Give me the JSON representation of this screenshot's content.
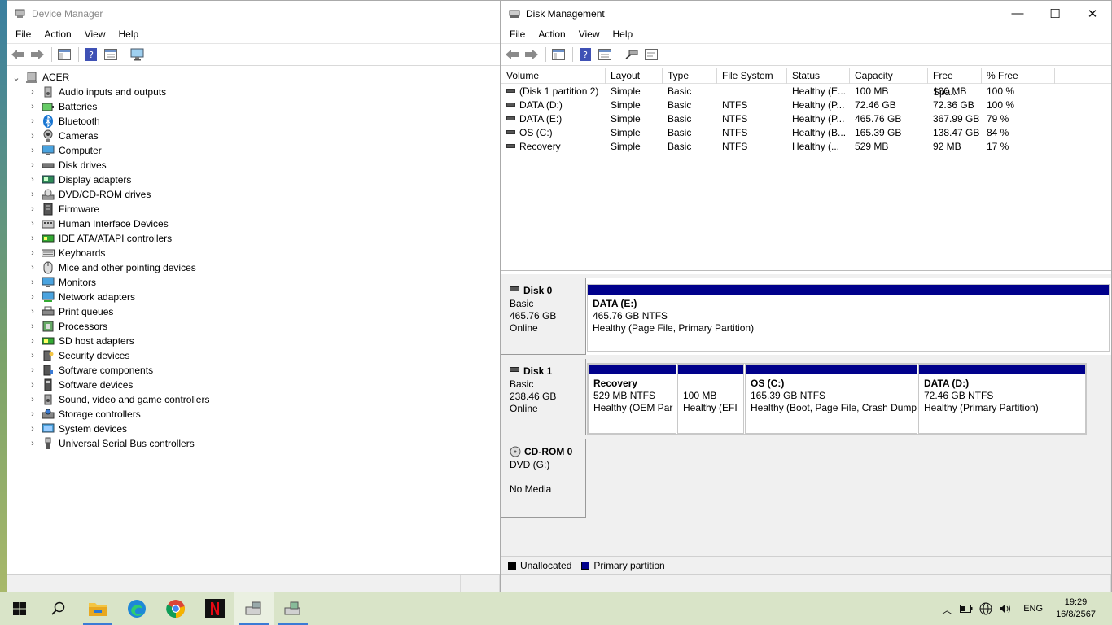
{
  "device_manager": {
    "title": "Device Manager",
    "menu": [
      "File",
      "Action",
      "View",
      "Help"
    ],
    "root": "ACER",
    "categories": [
      {
        "label": "Audio inputs and outputs",
        "icon": "speaker-icon"
      },
      {
        "label": "Batteries",
        "icon": "battery-icon"
      },
      {
        "label": "Bluetooth",
        "icon": "bluetooth-icon"
      },
      {
        "label": "Cameras",
        "icon": "camera-icon"
      },
      {
        "label": "Computer",
        "icon": "computer-icon"
      },
      {
        "label": "Disk drives",
        "icon": "disk-drive-icon"
      },
      {
        "label": "Display adapters",
        "icon": "display-adapter-icon"
      },
      {
        "label": "DVD/CD-ROM drives",
        "icon": "dvd-icon"
      },
      {
        "label": "Firmware",
        "icon": "firmware-icon"
      },
      {
        "label": "Human Interface Devices",
        "icon": "hid-icon"
      },
      {
        "label": "IDE ATA/ATAPI controllers",
        "icon": "ide-controller-icon"
      },
      {
        "label": "Keyboards",
        "icon": "keyboard-icon"
      },
      {
        "label": "Mice and other pointing devices",
        "icon": "mouse-icon"
      },
      {
        "label": "Monitors",
        "icon": "monitor-icon"
      },
      {
        "label": "Network adapters",
        "icon": "network-adapter-icon"
      },
      {
        "label": "Print queues",
        "icon": "printer-icon"
      },
      {
        "label": "Processors",
        "icon": "processor-icon"
      },
      {
        "label": "SD host adapters",
        "icon": "sd-card-icon"
      },
      {
        "label": "Security devices",
        "icon": "security-device-icon"
      },
      {
        "label": "Software components",
        "icon": "software-component-icon"
      },
      {
        "label": "Software devices",
        "icon": "software-device-icon"
      },
      {
        "label": "Sound, video and game controllers",
        "icon": "sound-controller-icon"
      },
      {
        "label": "Storage controllers",
        "icon": "storage-controller-icon"
      },
      {
        "label": "System devices",
        "icon": "system-device-icon"
      },
      {
        "label": "Universal Serial Bus controllers",
        "icon": "usb-icon"
      }
    ]
  },
  "disk_management": {
    "title": "Disk Management",
    "menu": [
      "File",
      "Action",
      "View",
      "Help"
    ],
    "columns": [
      "Volume",
      "Layout",
      "Type",
      "File System",
      "Status",
      "Capacity",
      "Free Spa...",
      "% Free"
    ],
    "volumes": [
      [
        "(Disk 1 partition 2)",
        "Simple",
        "Basic",
        "",
        "Healthy (E...",
        "100 MB",
        "100 MB",
        "100 %"
      ],
      [
        "DATA (D:)",
        "Simple",
        "Basic",
        "NTFS",
        "Healthy (P...",
        "72.46 GB",
        "72.36 GB",
        "100 %"
      ],
      [
        "DATA (E:)",
        "Simple",
        "Basic",
        "NTFS",
        "Healthy (P...",
        "465.76 GB",
        "367.99 GB",
        "79 %"
      ],
      [
        "OS (C:)",
        "Simple",
        "Basic",
        "NTFS",
        "Healthy (B...",
        "165.39 GB",
        "138.47 GB",
        "84 %"
      ],
      [
        "Recovery",
        "Simple",
        "Basic",
        "NTFS",
        "Healthy (...",
        "529 MB",
        "92 MB",
        "17 %"
      ]
    ],
    "disks": [
      {
        "name": "Disk 0",
        "type": "Basic",
        "size": "465.76 GB",
        "state": "Online",
        "partitions": [
          {
            "name": "DATA  (E:)",
            "size": "465.76 GB NTFS",
            "status": "Healthy (Page File, Primary Partition)"
          }
        ]
      },
      {
        "name": "Disk 1",
        "type": "Basic",
        "size": "238.46 GB",
        "state": "Online",
        "partitions": [
          {
            "name": "Recovery",
            "size": "529 MB NTFS",
            "status": "Healthy (OEM Par"
          },
          {
            "name": "",
            "size": "100 MB",
            "status": "Healthy (EFI"
          },
          {
            "name": "OS  (C:)",
            "size": "165.39 GB NTFS",
            "status": "Healthy (Boot, Page File, Crash Dump"
          },
          {
            "name": "DATA  (D:)",
            "size": "72.46 GB NTFS",
            "status": "Healthy (Primary Partition)"
          }
        ]
      },
      {
        "name": "CD-ROM 0",
        "type": "DVD (G:)",
        "size": "",
        "state": "No Media",
        "partitions": []
      }
    ],
    "legend": [
      {
        "label": "Unallocated",
        "color": "#000000"
      },
      {
        "label": "Primary partition",
        "color": "#00008b"
      }
    ]
  },
  "taskbar": {
    "apps": [
      "start-icon",
      "search-icon",
      "file-explorer-icon",
      "edge-icon",
      "chrome-icon",
      "netflix-icon",
      "device-manager-icon",
      "disk-management-icon"
    ],
    "language": "ENG",
    "time": "19:29",
    "date": "16/8/2567"
  }
}
